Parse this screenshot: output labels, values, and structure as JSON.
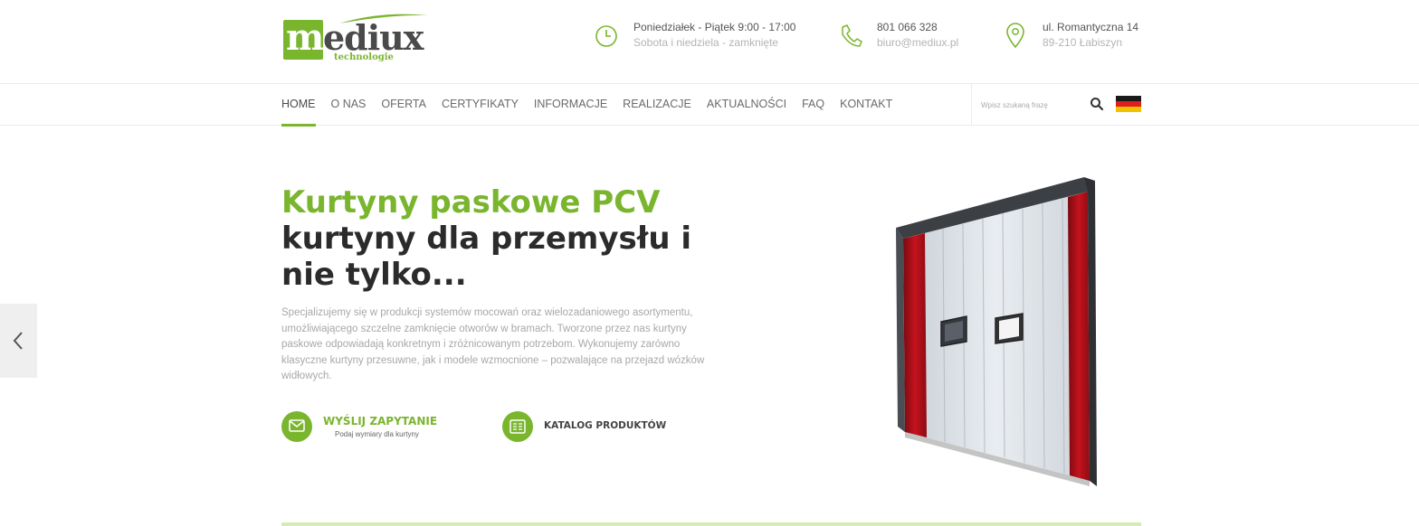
{
  "brand": {
    "logo_first_letter": "m",
    "logo_rest": "ediux",
    "logo_sub": "technologie"
  },
  "header": {
    "hours": {
      "line1": "Poniedziałek - Piątek 9:00 - 17:00",
      "line2": "Sobota i niedziela - zamknięte",
      "icon": "clock-icon"
    },
    "contact": {
      "line1": "801 066 328",
      "line2": "biuro@mediux.pl",
      "icon": "phone-icon"
    },
    "address": {
      "line1": "ul. Romantyczna 14",
      "line2": "89-210 Łabiszyn",
      "icon": "location-pin-icon"
    }
  },
  "nav": {
    "items": [
      {
        "label": "HOME",
        "active": true
      },
      {
        "label": "O NAS"
      },
      {
        "label": "OFERTA"
      },
      {
        "label": "CERTYFIKATY"
      },
      {
        "label": "INFORMACJE"
      },
      {
        "label": "REALIZACJE"
      },
      {
        "label": "AKTUALNOŚCI"
      },
      {
        "label": "FAQ"
      },
      {
        "label": "KONTAKT"
      }
    ],
    "search_placeholder": "Wpisz szukaną frazę",
    "language_flag": "flag-germany-icon"
  },
  "hero": {
    "title_green": "Kurtyny paskowe PCV",
    "title_dark": "kurtyny dla przemysłu i nie tylko...",
    "description": "Specjalizujemy się w produkcji systemów mocowań oraz wielozadaniowego asortymentu, umożliwiającego szczelne zamknięcie otworów w bramach. Tworzone przez nas kurtyny paskowe odpowiadają konkretnym i zróżnicowanym potrzebom. Wykonujemy zarówno klasyczne kurtyny przesuwne, jak i modele wzmocnione – pozwalające na przejazd wózków widłowych.",
    "cta_inquiry": {
      "label": "WYŚLIJ ZAPYTANIE",
      "sub": "Podaj wymiary dla kurtyny",
      "icon": "envelope-icon"
    },
    "cta_catalog": {
      "label": "KATALOG PRODUKTÓW",
      "icon": "catalog-icon"
    },
    "image_alt": "PCV strip curtain door"
  },
  "colors": {
    "accent": "#7ab52e",
    "text_dark": "#2b2b2b",
    "text_muted": "#a8a8a8",
    "curtain_red": "#b3101b"
  }
}
